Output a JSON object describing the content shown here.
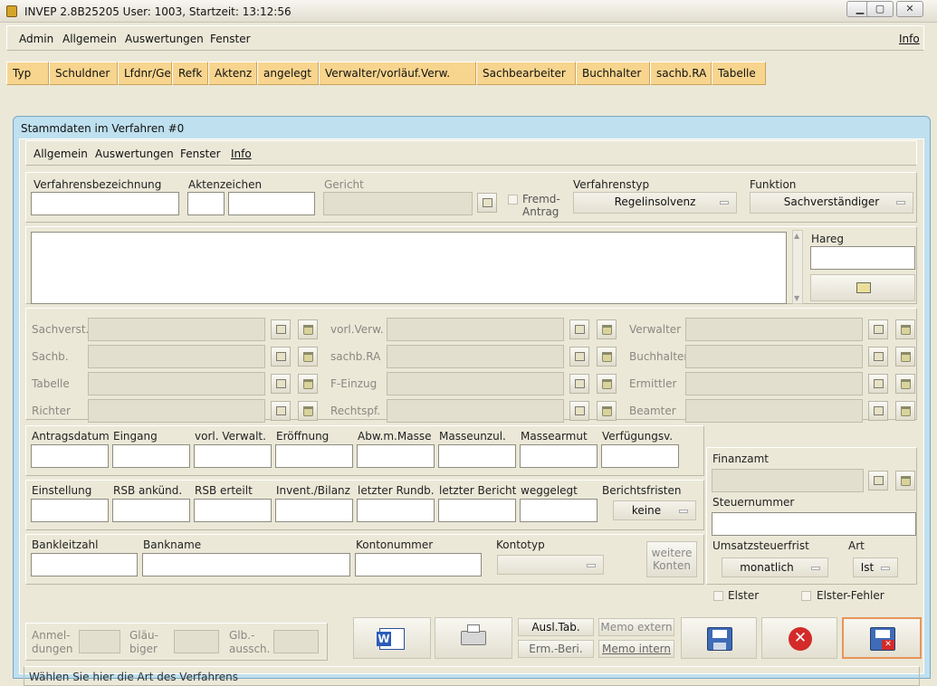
{
  "window": {
    "title": "INVEP 2.8B25205 User: 1003, Startzeit: 13:12:56"
  },
  "main_menu": {
    "admin": "Admin",
    "allgemein": "Allgemein",
    "auswertungen": "Auswertungen",
    "fenster": "Fenster",
    "info": "Info"
  },
  "columns": [
    "Typ",
    "Schuldner",
    "Lfdnr/Ge",
    "Refk",
    "Aktenz",
    "angelegt",
    "Verwalter/vorläuf.Verw.",
    "Sachbearbeiter",
    "Buchhalter",
    "sachb.RA",
    "Tabelle"
  ],
  "dialog": {
    "title": "Stammdaten im Verfahren #0",
    "menu": {
      "allgemein": "Allgemein",
      "auswertungen": "Auswertungen",
      "fenster": "Fenster",
      "info": "Info"
    },
    "top": {
      "verfahrensbezeichnung": "Verfahrensbezeichnung",
      "aktenzeichen": "Aktenzeichen",
      "gericht": "Gericht",
      "fremd_antrag_1": "Fremd-",
      "fremd_antrag_2": "Antrag",
      "verfahrenstyp": "Verfahrenstyp",
      "verfahrenstyp_value": "Regelinsolvenz",
      "funktion": "Funktion",
      "funktion_value": "Sachverständiger",
      "hareg": "Hareg"
    },
    "persons": {
      "sachverst": "Sachverst.",
      "sachb": "Sachb.",
      "tabelle": "Tabelle",
      "richter": "Richter",
      "vorl_verw": "vorl.Verw.",
      "sachb_ra": "sachb.RA",
      "f_einzug": "F-Einzug",
      "rechtspf": "Rechtspf.",
      "verwalter": "Verwalter",
      "buchhalter": "Buchhalter",
      "ermittler": "Ermittler",
      "beamter": "Beamter"
    },
    "dates1": {
      "antragsdatum": "Antragsdatum",
      "eingang": "Eingang",
      "vorl_verwalt": "vorl. Verwalt.",
      "eroeffnung": "Eröffnung",
      "abw_masse": "Abw.m.Masse",
      "masseunzul": "Masseunzul.",
      "massearmut": "Massearmut",
      "verfuegungsv": "Verfügungsv."
    },
    "dates2": {
      "einstellung": "Einstellung",
      "rsb_ankuend": "RSB ankünd.",
      "rsb_erteilt": "RSB erteilt",
      "invent_bilanz": "Invent./Bilanz",
      "letzter_rundb": "letzter Rundb.",
      "letzter_bericht": "letzter Bericht",
      "weggelegt": "weggelegt",
      "berichtsfristen": "Berichtsfristen",
      "berichtsfristen_value": "keine"
    },
    "bank": {
      "bankleitzahl": "Bankleitzahl",
      "bankname": "Bankname",
      "kontonummer": "Kontonummer",
      "kontotyp": "Kontotyp",
      "weitere_1": "weitere",
      "weitere_2": "Konten"
    },
    "finanz": {
      "finanzamt": "Finanzamt",
      "steuernummer": "Steuernummer",
      "ust_frist": "Umsatzsteuerfrist",
      "ust_frist_value": "monatlich",
      "art": "Art",
      "art_value": "Ist",
      "elster": "Elster",
      "elster_fehler": "Elster-Fehler"
    },
    "counts": {
      "anmel_1": "Anmel-",
      "anmel_2": "dungen",
      "glaeu_1": "Gläu-",
      "glaeu_2": "biger",
      "glb_1": "Glb.-",
      "glb_2": "aussch."
    },
    "buttons": {
      "ausl_tab": "Ausl.Tab.",
      "erm_beri": "Erm.-Beri.",
      "memo_extern": "Memo extern",
      "memo_intern": "Memo intern"
    },
    "status": "Wählen Sie hier die Art des Verfahrens"
  }
}
